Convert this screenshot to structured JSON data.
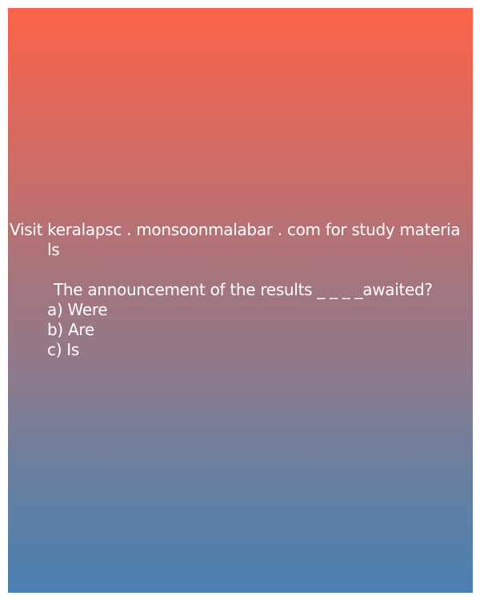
{
  "promo": {
    "line1": "Visit keralapsc . monsoonmalabar . com for study materia",
    "line2": "ls"
  },
  "question": {
    "text": "The announcement of the results _ _ _ _awaited?",
    "options": [
      "a) Were",
      "b) Are",
      "c) Is"
    ]
  },
  "colors": {
    "gradient_top": "#fc634a",
    "gradient_bottom": "#4a80b2",
    "text": "#ffffff"
  }
}
